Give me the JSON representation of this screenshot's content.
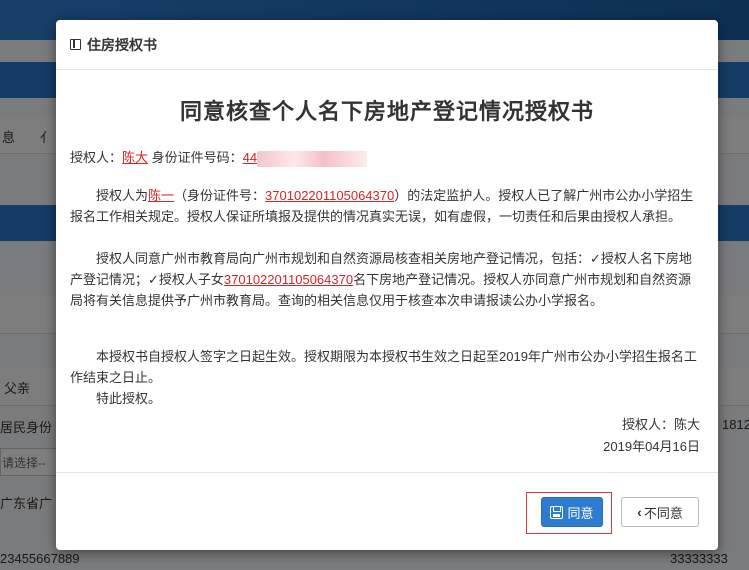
{
  "background": {
    "fragments": [
      "息",
      "亻",
      "父亲",
      "居民身份",
      "请选择--",
      "广东省广",
      "1812",
      "23455667889",
      "33333333"
    ]
  },
  "modal": {
    "title": "住房授权书",
    "doc_title": "同意核查个人名下房地产登记情况授权书",
    "grantor_line": {
      "label": "授权人：",
      "name": "陈大",
      "id_label": "身份证件号码：",
      "id_visible": "44"
    },
    "para1": {
      "t1": "授权人为",
      "guardian_name": "陈一",
      "t2": "（身份证件号：",
      "id_number": "370102201105064370",
      "t3": "）的法定监护人。授权人已了解广州市公办小学招生报名工作相关规定。授权人保证所填报及提供的情况真实无误，如有虚假，一切责任和后果由授权人承担。"
    },
    "para2": {
      "t1": "授权人同意广州市教育局向广州市规划和自然资源局核查相关房地产登记情况，包括：✓授权人名下房地产登记情况；✓授权人子女",
      "child_id": "370102201105064370",
      "t2": "名下房地产登记情况。授权人亦同意广州市规划和自然资源局将有关信息提供予广州市教育局。查询的相关信息仅用于核查本次申请报读公办小学报名。"
    },
    "para3": "本授权书自授权人签字之日起生效。授权期限为本授权书生效之日起至2019年广州市公办小学招生报名工作结束之日止。",
    "para4": "特此授权。",
    "signature": {
      "grantor": "授权人：陈大",
      "date": "2019年04月16日"
    },
    "buttons": {
      "agree": "同意",
      "disagree": "不同意"
    }
  },
  "colors": {
    "accent": "#2f7bd0",
    "highlight_red": "#d22222",
    "overlay": "rgba(0,0,0,0.5)"
  }
}
